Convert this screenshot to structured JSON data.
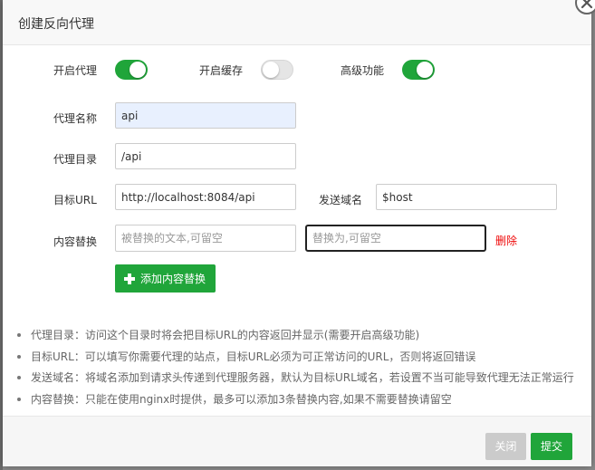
{
  "dialog": {
    "title": "创建反向代理"
  },
  "toggles": [
    {
      "label": "开启代理",
      "state": "on"
    },
    {
      "label": "开启缓存",
      "state": "off"
    },
    {
      "label": "高级功能",
      "state": "on"
    }
  ],
  "fields": {
    "proxy_name": {
      "label": "代理名称",
      "value": "api"
    },
    "proxy_dir": {
      "label": "代理目录",
      "value": "/api"
    },
    "target_url": {
      "label": "目标URL",
      "value": "http://localhost:8084/api"
    },
    "send_domain": {
      "label": "发送域名",
      "value": "$host"
    },
    "content_replace": {
      "label": "内容替换",
      "from_placeholder": "被替换的文本,可留空",
      "to_placeholder": "替换为,可留空",
      "delete_label": "删除"
    }
  },
  "add_replace_button": "添加内容替换",
  "help": [
    "代理目录：访问这个目录时将会把目标URL的内容返回并显示(需要开启高级功能)",
    "目标URL：可以填写你需要代理的站点，目标URL必须为可正常访问的URL，否则将返回错误",
    "发送域名：将域名添加到请求头传递到代理服务器，默认为目标URL域名，若设置不当可能导致代理无法正常运行",
    "内容替换：只能在使用nginx时提供，最多可以添加3条替换内容,如果不需要替换请留空"
  ],
  "footer": {
    "close_label": "关闭",
    "submit_label": "提交"
  },
  "colors": {
    "accent": "#20a53a",
    "danger": "#ef0808"
  }
}
